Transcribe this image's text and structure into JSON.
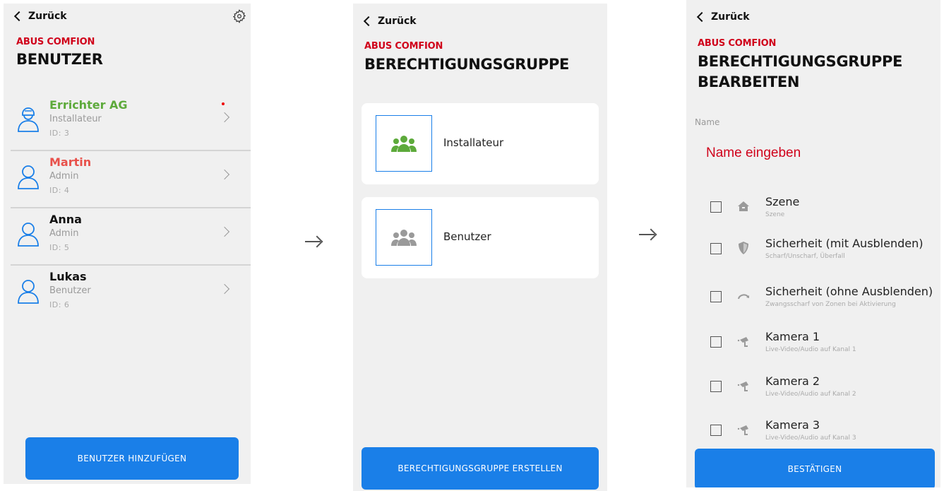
{
  "colors": {
    "brand": "#d0021b",
    "accent": "#1a7fe8",
    "green": "#5daa3b",
    "red_name": "#e8514b",
    "bg": "#f0f0f0"
  },
  "screen1": {
    "back_label": "Zurück",
    "brand": "ABUS COMFION",
    "title": "BENUTZER",
    "settings_icon": "gear-icon",
    "users": [
      {
        "name": "Errichter AG",
        "role": "Installateur",
        "id": "ID: 3",
        "color": "#5daa3b",
        "icon": "installer-avatar-icon"
      },
      {
        "name": "Martin",
        "role": "Admin",
        "id": "ID: 4",
        "color": "#e8514b",
        "icon": "user-avatar-icon"
      },
      {
        "name": "Anna",
        "role": "Admin",
        "id": "ID: 5",
        "color": "#111111",
        "icon": "user-avatar-icon"
      },
      {
        "name": "Lukas",
        "role": "Benutzer",
        "id": "ID: 6",
        "color": "#111111",
        "icon": "user-avatar-icon"
      }
    ],
    "add_button": "BENUTZER HINZUFÜGEN"
  },
  "screen2": {
    "back_label": "Zurück",
    "brand": "ABUS COMFION",
    "title": "BERECHTIGUNGSGRUPPE",
    "groups": [
      {
        "label": "Installateur",
        "icon": "group-icon",
        "icon_color": "#5daa3b"
      },
      {
        "label": "Benutzer",
        "icon": "group-icon",
        "icon_color": "#9a9a9a"
      }
    ],
    "create_button": "BERECHTIGUNGSGRUPPE ERSTELLEN"
  },
  "screen3": {
    "back_label": "Zurück",
    "brand": "ABUS COMFION",
    "title_line1": "BERECHTIGUNGSGRUPPE",
    "title_line2": "BEARBEITEN",
    "name_label": "Name",
    "name_placeholder": "Name eingeben",
    "permissions": [
      {
        "title": "Szene",
        "subtitle": "Szene",
        "icon": "home-icon"
      },
      {
        "title": "Sicherheit (mit Ausblenden)",
        "subtitle": "Scharf/Unscharf, Überfall",
        "icon": "shield-icon"
      },
      {
        "title": "Sicherheit (ohne Ausblenden)",
        "subtitle": "Zwangsscharf von Zonen bei Aktivierung",
        "icon": "redo-arrow-icon"
      },
      {
        "title": "Kamera 1",
        "subtitle": "Live-Video/Audio auf Kanal 1",
        "icon": "camera-icon"
      },
      {
        "title": "Kamera 2",
        "subtitle": "Live-Video/Audio auf Kanal 2",
        "icon": "camera-icon"
      },
      {
        "title": "Kamera 3",
        "subtitle": "Live-Video/Audio auf Kanal 3",
        "icon": "camera-icon"
      }
    ],
    "confirm_button": "BESTÄTIGEN"
  }
}
